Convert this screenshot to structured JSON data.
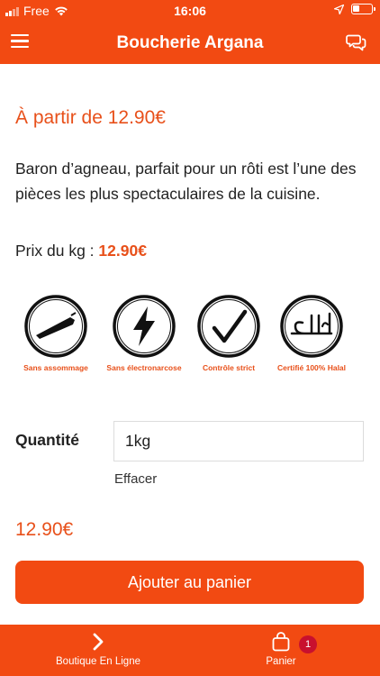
{
  "status_bar": {
    "carrier": "Free",
    "time": "16:06"
  },
  "header": {
    "title": "Boucherie Argana",
    "menu_icon": "hamburger-menu-icon",
    "chat_icon": "chat-bubbles-icon"
  },
  "product": {
    "price_from": "À partir de 12.90€",
    "description": "Baron d’agneau, parfait pour un rôti est l’une des pièces les plus spectaculaires de la cuisine.",
    "price_per_kg_label": "Prix du kg :",
    "price_per_kg_value": "12.90€"
  },
  "badges": [
    {
      "label": "Sans assommage",
      "icon": "stun-gun-icon"
    },
    {
      "label": "Sans électronarcose",
      "icon": "lightning-bolt-icon"
    },
    {
      "label": "Contrôle strict",
      "icon": "checkmark-icon"
    },
    {
      "label": "Certifié 100% Halal",
      "icon": "halal-arabic-icon"
    }
  ],
  "quantity": {
    "label": "Quantité",
    "value": "1kg",
    "clear_label": "Effacer"
  },
  "total_price": "12.90€",
  "add_to_cart_label": "Ajouter au panier",
  "tab_bar": {
    "shop_label": "Boutique En Ligne",
    "shop_icon": "chevron-right-icon",
    "cart_label": "Panier",
    "cart_icon": "shopping-bag-icon",
    "cart_count": "1"
  },
  "colors": {
    "brand": "#f24a12",
    "accent_text": "#e8501a",
    "cart_badge": "#c8102e"
  }
}
